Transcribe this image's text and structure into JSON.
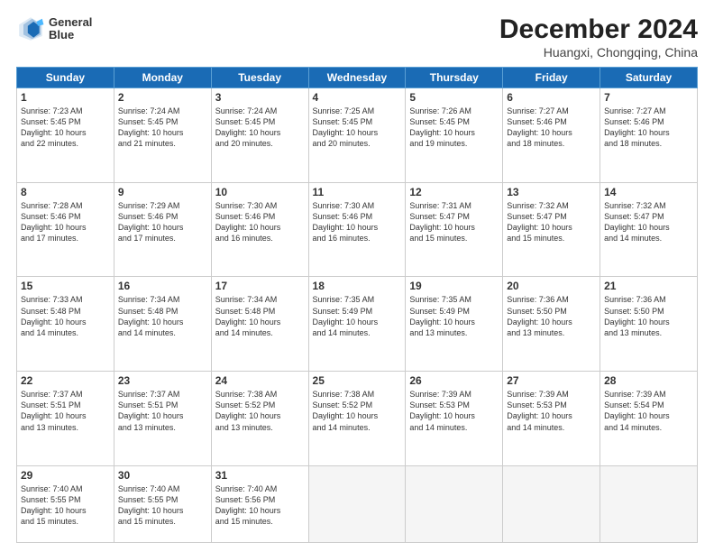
{
  "logo": {
    "line1": "General",
    "line2": "Blue"
  },
  "title": "December 2024",
  "subtitle": "Huangxi, Chongqing, China",
  "weekdays": [
    "Sunday",
    "Monday",
    "Tuesday",
    "Wednesday",
    "Thursday",
    "Friday",
    "Saturday"
  ],
  "weeks": [
    [
      {
        "day": "1",
        "info": "Sunrise: 7:23 AM\nSunset: 5:45 PM\nDaylight: 10 hours\nand 22 minutes."
      },
      {
        "day": "2",
        "info": "Sunrise: 7:24 AM\nSunset: 5:45 PM\nDaylight: 10 hours\nand 21 minutes."
      },
      {
        "day": "3",
        "info": "Sunrise: 7:24 AM\nSunset: 5:45 PM\nDaylight: 10 hours\nand 20 minutes."
      },
      {
        "day": "4",
        "info": "Sunrise: 7:25 AM\nSunset: 5:45 PM\nDaylight: 10 hours\nand 20 minutes."
      },
      {
        "day": "5",
        "info": "Sunrise: 7:26 AM\nSunset: 5:45 PM\nDaylight: 10 hours\nand 19 minutes."
      },
      {
        "day": "6",
        "info": "Sunrise: 7:27 AM\nSunset: 5:46 PM\nDaylight: 10 hours\nand 18 minutes."
      },
      {
        "day": "7",
        "info": "Sunrise: 7:27 AM\nSunset: 5:46 PM\nDaylight: 10 hours\nand 18 minutes."
      }
    ],
    [
      {
        "day": "8",
        "info": "Sunrise: 7:28 AM\nSunset: 5:46 PM\nDaylight: 10 hours\nand 17 minutes."
      },
      {
        "day": "9",
        "info": "Sunrise: 7:29 AM\nSunset: 5:46 PM\nDaylight: 10 hours\nand 17 minutes."
      },
      {
        "day": "10",
        "info": "Sunrise: 7:30 AM\nSunset: 5:46 PM\nDaylight: 10 hours\nand 16 minutes."
      },
      {
        "day": "11",
        "info": "Sunrise: 7:30 AM\nSunset: 5:46 PM\nDaylight: 10 hours\nand 16 minutes."
      },
      {
        "day": "12",
        "info": "Sunrise: 7:31 AM\nSunset: 5:47 PM\nDaylight: 10 hours\nand 15 minutes."
      },
      {
        "day": "13",
        "info": "Sunrise: 7:32 AM\nSunset: 5:47 PM\nDaylight: 10 hours\nand 15 minutes."
      },
      {
        "day": "14",
        "info": "Sunrise: 7:32 AM\nSunset: 5:47 PM\nDaylight: 10 hours\nand 14 minutes."
      }
    ],
    [
      {
        "day": "15",
        "info": "Sunrise: 7:33 AM\nSunset: 5:48 PM\nDaylight: 10 hours\nand 14 minutes."
      },
      {
        "day": "16",
        "info": "Sunrise: 7:34 AM\nSunset: 5:48 PM\nDaylight: 10 hours\nand 14 minutes."
      },
      {
        "day": "17",
        "info": "Sunrise: 7:34 AM\nSunset: 5:48 PM\nDaylight: 10 hours\nand 14 minutes."
      },
      {
        "day": "18",
        "info": "Sunrise: 7:35 AM\nSunset: 5:49 PM\nDaylight: 10 hours\nand 14 minutes."
      },
      {
        "day": "19",
        "info": "Sunrise: 7:35 AM\nSunset: 5:49 PM\nDaylight: 10 hours\nand 13 minutes."
      },
      {
        "day": "20",
        "info": "Sunrise: 7:36 AM\nSunset: 5:50 PM\nDaylight: 10 hours\nand 13 minutes."
      },
      {
        "day": "21",
        "info": "Sunrise: 7:36 AM\nSunset: 5:50 PM\nDaylight: 10 hours\nand 13 minutes."
      }
    ],
    [
      {
        "day": "22",
        "info": "Sunrise: 7:37 AM\nSunset: 5:51 PM\nDaylight: 10 hours\nand 13 minutes."
      },
      {
        "day": "23",
        "info": "Sunrise: 7:37 AM\nSunset: 5:51 PM\nDaylight: 10 hours\nand 13 minutes."
      },
      {
        "day": "24",
        "info": "Sunrise: 7:38 AM\nSunset: 5:52 PM\nDaylight: 10 hours\nand 13 minutes."
      },
      {
        "day": "25",
        "info": "Sunrise: 7:38 AM\nSunset: 5:52 PM\nDaylight: 10 hours\nand 14 minutes."
      },
      {
        "day": "26",
        "info": "Sunrise: 7:39 AM\nSunset: 5:53 PM\nDaylight: 10 hours\nand 14 minutes."
      },
      {
        "day": "27",
        "info": "Sunrise: 7:39 AM\nSunset: 5:53 PM\nDaylight: 10 hours\nand 14 minutes."
      },
      {
        "day": "28",
        "info": "Sunrise: 7:39 AM\nSunset: 5:54 PM\nDaylight: 10 hours\nand 14 minutes."
      }
    ],
    [
      {
        "day": "29",
        "info": "Sunrise: 7:40 AM\nSunset: 5:55 PM\nDaylight: 10 hours\nand 15 minutes."
      },
      {
        "day": "30",
        "info": "Sunrise: 7:40 AM\nSunset: 5:55 PM\nDaylight: 10 hours\nand 15 minutes."
      },
      {
        "day": "31",
        "info": "Sunrise: 7:40 AM\nSunset: 5:56 PM\nDaylight: 10 hours\nand 15 minutes."
      },
      {
        "day": "",
        "info": ""
      },
      {
        "day": "",
        "info": ""
      },
      {
        "day": "",
        "info": ""
      },
      {
        "day": "",
        "info": ""
      }
    ]
  ]
}
